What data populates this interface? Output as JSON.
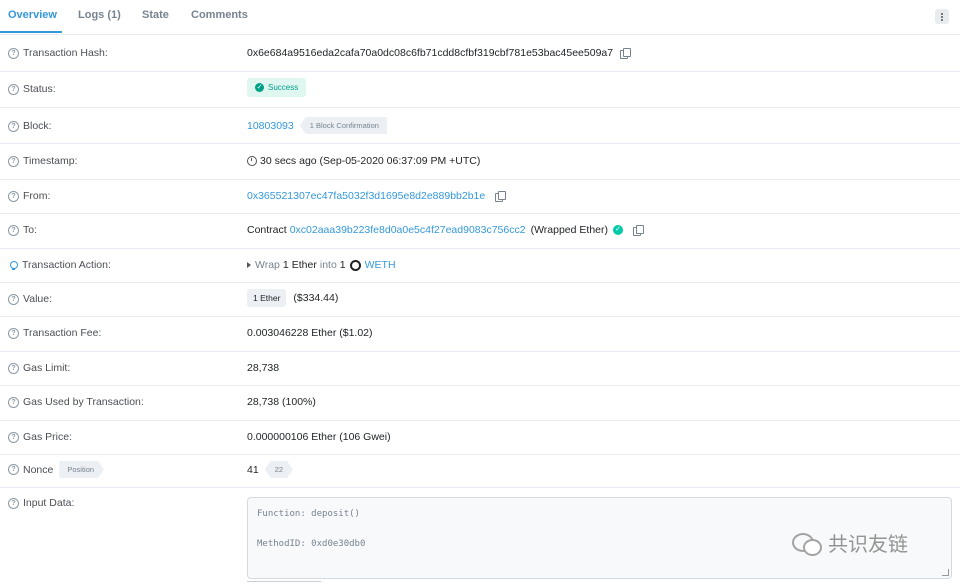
{
  "tabs": [
    {
      "label": "Overview",
      "active": true
    },
    {
      "label": "Logs (1)",
      "active": false
    },
    {
      "label": "State",
      "active": false
    },
    {
      "label": "Comments",
      "active": false
    }
  ],
  "colors": {
    "accent": "#3498db",
    "success": "#00a186",
    "success_bg": "#dff6f1",
    "border": "#e7eaf3"
  },
  "rows": {
    "tx_hash": {
      "label": "Transaction Hash:",
      "value": "0x6e684a9516eda2cafa70a0dc08c6fb71cdd8cfbf319cbf781e53bac45ee509a7"
    },
    "status": {
      "label": "Status:",
      "value": "Success"
    },
    "block": {
      "label": "Block:",
      "value": "10803093",
      "confirmations": "1 Block Confirmation"
    },
    "timestamp": {
      "label": "Timestamp:",
      "value": "30 secs ago (Sep-05-2020 06:37:09 PM +UTC)"
    },
    "from": {
      "label": "From:",
      "value": "0x365521307ec47fa5032f3d1695e8d2e889bb2b1e"
    },
    "to": {
      "label": "To:",
      "prefix": "Contract",
      "value": "0xc02aaa39b223fe8d0a0e5c4f27ead9083c756cc2",
      "name": "(Wrapped Ether)"
    },
    "action": {
      "label": "Transaction Action:",
      "verb": "Wrap",
      "amount": "1",
      "unit": "Ether",
      "into": "into",
      "amount2": "1",
      "token": "WETH"
    },
    "value": {
      "label": "Value:",
      "value": "1 Ether",
      "usd": "($334.44)"
    },
    "fee": {
      "label": "Transaction Fee:",
      "value": "0.003046228 Ether ($1.02)"
    },
    "gas_limit": {
      "label": "Gas Limit:",
      "value": "28,738"
    },
    "gas_used": {
      "label": "Gas Used by Transaction:",
      "value": "28,738 (100%)"
    },
    "gas_price": {
      "label": "Gas Price:",
      "value": "0.000000106 Ether (106 Gwei)"
    },
    "nonce": {
      "label": "Nonce",
      "position_tag": "Position",
      "value": "41",
      "position": "22"
    },
    "input": {
      "label": "Input Data:",
      "line1": "Function: deposit()",
      "line2": "MethodID: 0xd0e30db0"
    }
  },
  "watermark": "共识友链"
}
